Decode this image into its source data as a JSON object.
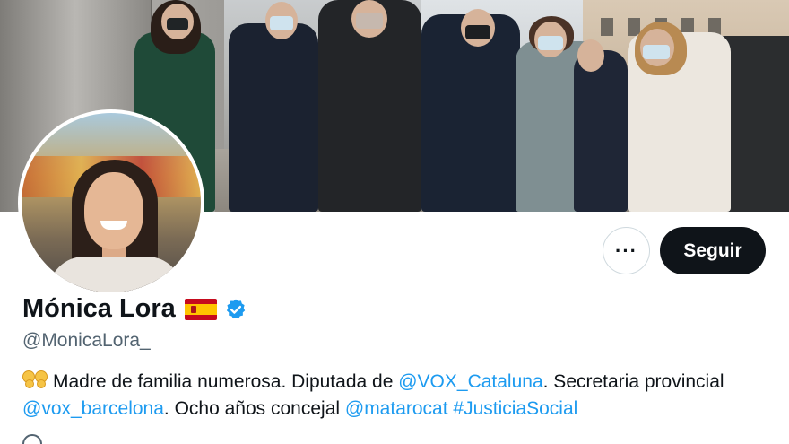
{
  "profile": {
    "name": "Mónica Lora",
    "handle": "@MonicaLora_",
    "more_label": "···",
    "follow_label": "Seguir",
    "bio": {
      "t1": "Madre de familia numerosa. Diputada de ",
      "l1": "@VOX_Cataluna",
      "t2": ". Secretaria provincial",
      "l2": "@vox_barcelona",
      "t3": ". Ocho años concejal ",
      "l3": "@matarocat",
      "l4": "#JusticiaSocial"
    }
  },
  "icons": {
    "flag": "spain-flag-icon",
    "verified": "verified-badge-icon",
    "bio_emoji": "family-emoji-icon"
  },
  "colors": {
    "accent": "#1d9bf0",
    "follow_bg": "#0f1419",
    "secondary_text": "#536471"
  }
}
